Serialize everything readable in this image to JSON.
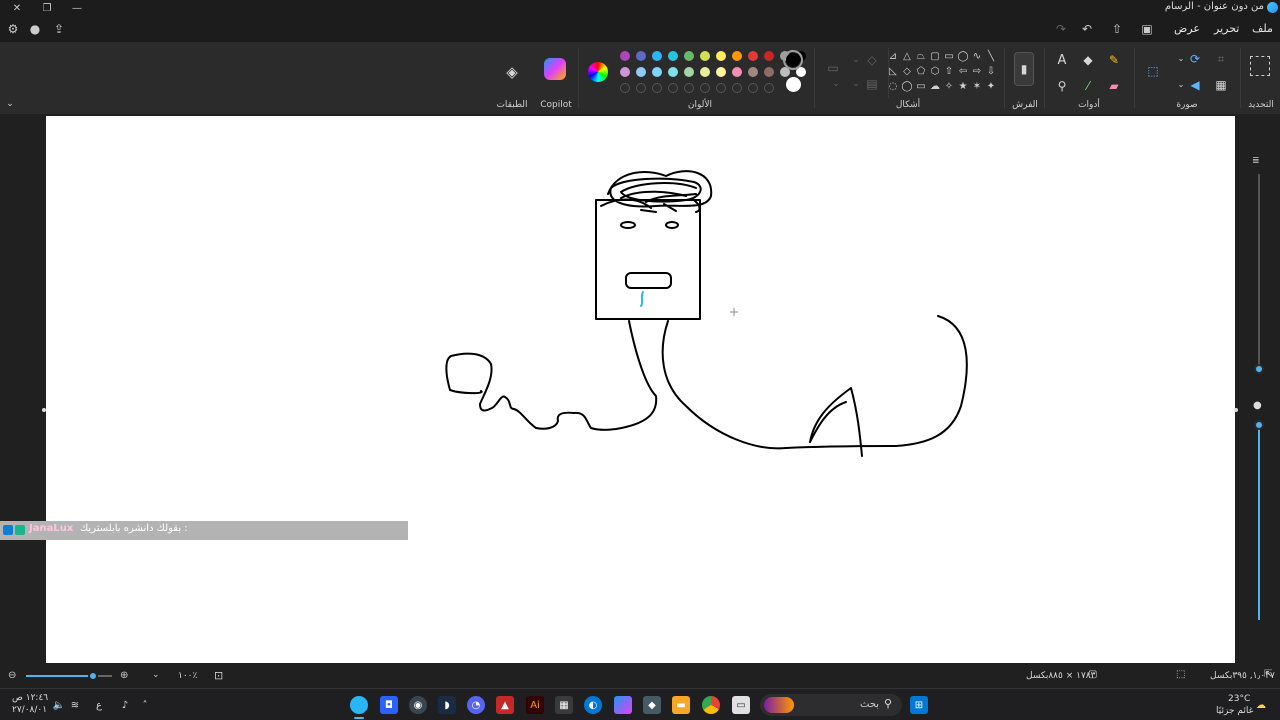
{
  "window": {
    "title": "من دون عنوان - الرسام",
    "close": "✕",
    "maximize": "❐",
    "minimize": "—"
  },
  "menu": {
    "file": "ملف",
    "edit": "تحرير",
    "view": "عرض"
  },
  "ribbon": {
    "groups": {
      "selection": "التحديد",
      "image": "صورة",
      "tools": "أدوات",
      "brushes": "الفرش",
      "shapes": "أشكال",
      "colors": "الألوان",
      "copilot": "Copilot",
      "layers": "الطبقات"
    },
    "palette_row1": [
      "#ab47bc",
      "#5c6bc0",
      "#29b6f6",
      "#26c6da",
      "#66bb6a",
      "#d4e157",
      "#ffee58",
      "#ff9800",
      "#e53935",
      "#c62828",
      "#9e9e9e",
      "#000000"
    ],
    "palette_row2": [
      "#ce93d8",
      "#90caf9",
      "#81d4fa",
      "#80deea",
      "#a5d6a7",
      "#e6ee9c",
      "#fff59d",
      "#f48fb1",
      "#a1887f",
      "#8d6e63",
      "#bdbdbd",
      "#ffffff"
    ],
    "primary_color": "#000000",
    "secondary_color": "#ffffff"
  },
  "overlay": {
    "username": "JanaLux",
    "message": "بقولك دانشره بابلستريك :"
  },
  "status": {
    "cursor_pos": "١٫٠٢٧, ٣٩٥بكسل",
    "canvas_size": "١٧٨٣ × ٨٨٥بكسل",
    "zoom": "١٠٠٪",
    "zoom_level": 0.78
  },
  "taskbar": {
    "search_placeholder": "بحث",
    "weather_temp": "23°C",
    "weather_desc": "غائم جزئيًا",
    "time": "١٢:٤٦ ص",
    "date": "٢٧/٠٨/٠١",
    "lang": "ع"
  }
}
